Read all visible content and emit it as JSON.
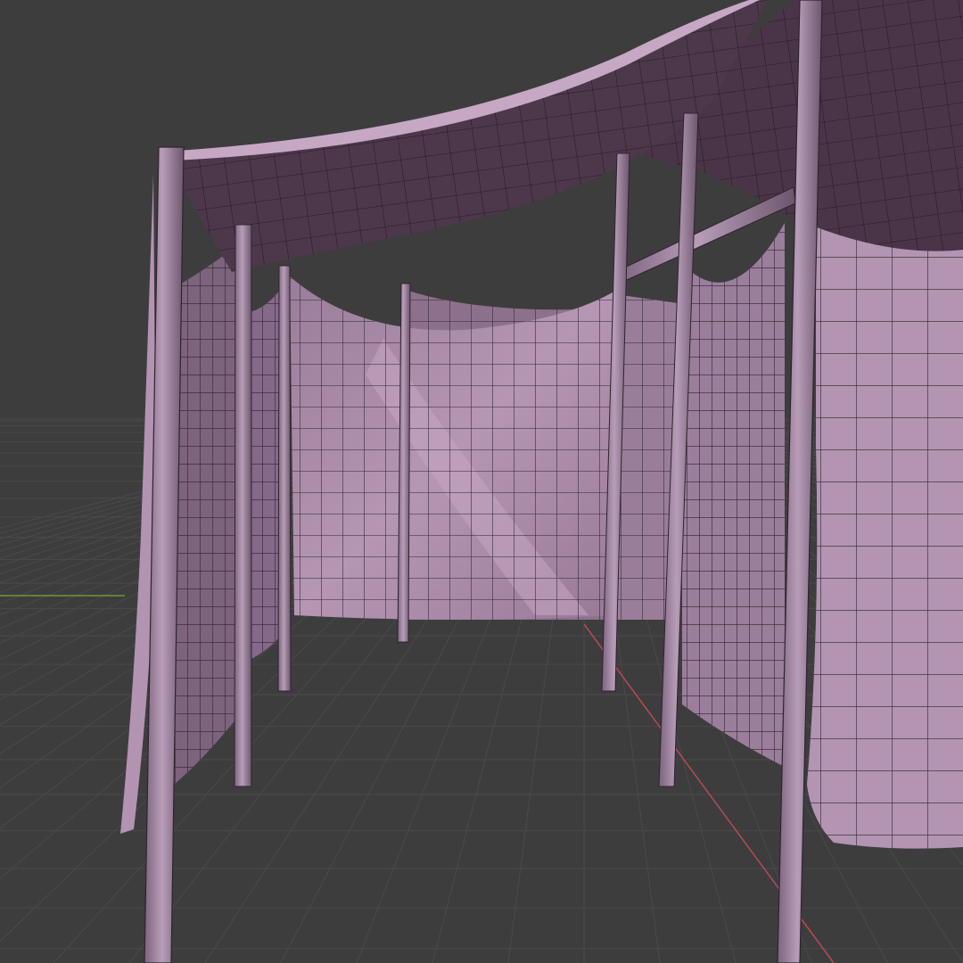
{
  "viewport": {
    "background": "#3d3d3d",
    "grid_color": "#4a4a4a",
    "x_axis_color": "#b84a52",
    "y_axis_color": "#6a9a3a"
  },
  "model": {
    "cloth_color": "#a78aa6",
    "cloth_shade": "#8e7290",
    "cloth_dark": "#4a3548",
    "pole_color": "#9b7f9c",
    "wire_color": "#2f2430"
  }
}
